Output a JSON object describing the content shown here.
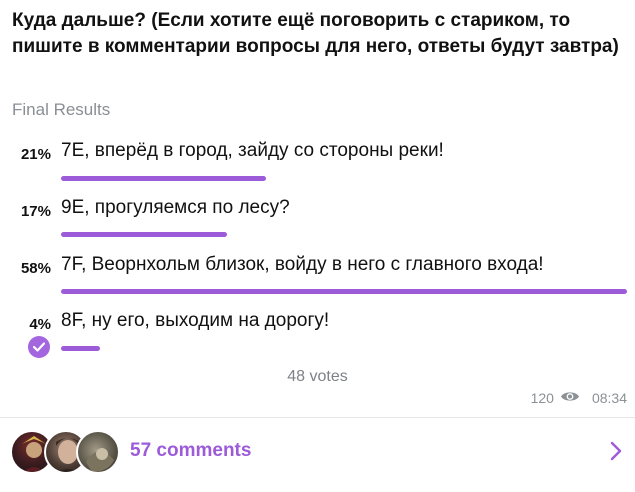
{
  "poll": {
    "question": "Куда дальше? (Если хотите ещё поговорить с стариком, то пишите в комментарии вопросы для него, ответы будут завтра)",
    "status": "Final Results",
    "options": [
      {
        "percent": "21%",
        "text": "7E, вперёд в город, зайду со стороны реки!",
        "share": 0.21
      },
      {
        "percent": "17%",
        "text": "9E, прогуляемся по лесу?",
        "share": 0.17
      },
      {
        "percent": "58%",
        "text": "7F, Веорнхольм близок, войду в него с главного входа!",
        "share": 0.58
      },
      {
        "percent": "4%",
        "text": "8F, ну его, выходим на дорогу!",
        "share": 0.04,
        "chosen": true
      }
    ],
    "total_votes": "48 votes",
    "views": "120",
    "time": "08:34"
  },
  "comments": {
    "label": "57 comments"
  },
  "icons": {
    "check": "check-icon",
    "views": "eye-icon",
    "chevron": "chevron-right-icon"
  },
  "colors": {
    "accent": "#9c5bd9",
    "text": "#111111",
    "muted": "#8a8f94"
  }
}
